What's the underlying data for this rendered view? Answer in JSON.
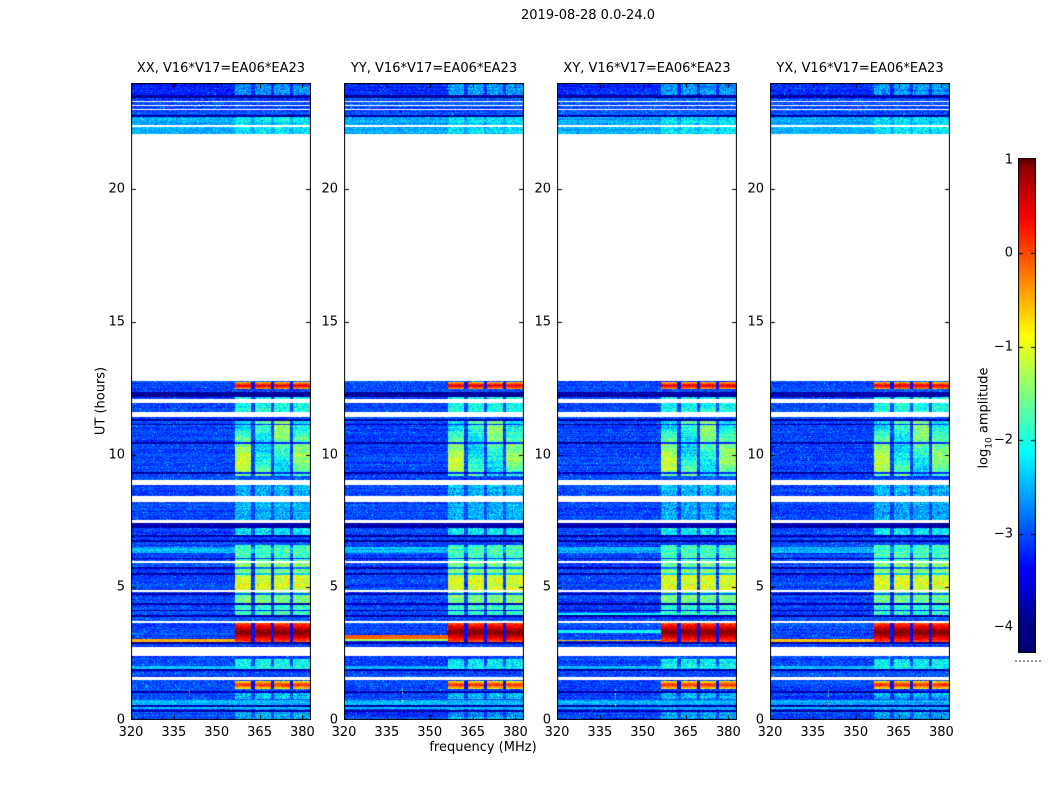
{
  "chart_data": {
    "type": "heatmap",
    "title": "2019-08-28 0.0-24.0",
    "panels": [
      {
        "id": "XX",
        "title": "XX, V16*V17=EA06*EA23",
        "seed": 1
      },
      {
        "id": "YY",
        "title": "YY, V16*V17=EA06*EA23",
        "seed": 2
      },
      {
        "id": "XY",
        "title": "XY, V16*V17=EA06*EA23",
        "seed": 3
      },
      {
        "id": "YX",
        "title": "YX, V16*V17=EA06*EA23",
        "seed": 4
      }
    ],
    "x_axis": {
      "label": "frequency (MHz)",
      "range": [
        320,
        383
      ],
      "ticks": [
        320,
        335,
        350,
        365,
        380
      ]
    },
    "y_axis": {
      "label": "UT (hours)",
      "range": [
        0,
        24
      ],
      "ticks": [
        0,
        5,
        10,
        15,
        20
      ]
    },
    "colorbar": {
      "label": "log10 amplitude",
      "colormap": "jet",
      "range": [
        -4,
        1
      ],
      "ticks": [
        1,
        0,
        -1,
        -2,
        -3,
        -4
      ]
    },
    "time_coverage": [
      [
        0,
        12.78
      ],
      [
        22.06,
        24.0
      ]
    ],
    "background_level": -3.05,
    "features": {
      "row_base": [
        [
          23.55,
          24.01,
          -3.2
        ],
        [
          22.8,
          23.45,
          -3.0
        ],
        [
          22.06,
          22.72,
          -2.55
        ]
      ],
      "white_stripes_hours": [
        [
          11.94,
          12.09
        ],
        [
          11.41,
          11.6
        ],
        [
          8.85,
          9.04
        ],
        [
          8.2,
          8.45
        ],
        [
          7.42,
          7.53
        ],
        [
          5.9,
          5.98
        ],
        [
          4.83,
          4.9
        ],
        [
          3.65,
          3.73
        ],
        [
          2.4,
          2.75
        ],
        [
          1.5,
          1.62
        ],
        [
          23.28,
          23.34
        ],
        [
          23.12,
          23.18
        ],
        [
          22.97,
          23.03
        ],
        [
          22.36,
          22.42
        ]
      ],
      "dark_lines_hours": [
        [
          12.17,
          12.36
        ],
        [
          11.28,
          11.33
        ],
        [
          11.1,
          11.15
        ],
        [
          10.4,
          10.48
        ],
        [
          9.28,
          9.33
        ],
        [
          7.23,
          7.42
        ],
        [
          6.9,
          6.97
        ],
        [
          6.72,
          6.78
        ],
        [
          6.05,
          6.12
        ],
        [
          5.7,
          5.78
        ],
        [
          5.45,
          5.52
        ],
        [
          4.72,
          4.78
        ],
        [
          4.35,
          4.42
        ],
        [
          4.1,
          4.16
        ],
        [
          3.88,
          3.94
        ],
        [
          2.88,
          2.95
        ],
        [
          1.86,
          1.92
        ],
        [
          1.0,
          1.1
        ],
        [
          0.5,
          0.56
        ],
        [
          0.3,
          0.36
        ],
        [
          23.45,
          23.55
        ],
        [
          22.72,
          22.8
        ]
      ],
      "bright_stripes_hours": [
        [
          6.3,
          6.5
        ],
        [
          1.92,
          2.05
        ],
        [
          0.4,
          0.75
        ]
      ],
      "rfi_band": {
        "freq_columns": [
          [
            356.5,
            362
          ],
          [
            363.5,
            369
          ],
          [
            370.2,
            375.5
          ],
          [
            376.8,
            382.5
          ]
        ],
        "activity": [
          {
            "hours": [
              12.47,
              12.72
            ],
            "level": 0.05,
            "style": "hot"
          },
          {
            "hours": [
              11.6,
              12.17
            ],
            "level": -2.05
          },
          {
            "hours": [
              9.2,
              11.28
            ],
            "level": -1.85,
            "blobby": true
          },
          {
            "hours": [
              8.45,
              8.85
            ],
            "level": -2.5
          },
          {
            "hours": [
              7.55,
              8.2
            ],
            "level": -2.55
          },
          {
            "hours": [
              6.97,
              7.23
            ],
            "level": -2.2
          },
          {
            "hours": [
              5.98,
              6.6
            ],
            "level": -1.8
          },
          {
            "hours": [
              5.52,
              5.9
            ],
            "level": -1.5
          },
          {
            "hours": [
              4.9,
              5.52
            ],
            "level": -1.05
          },
          {
            "hours": [
              4.42,
              4.83
            ],
            "level": -1.55
          },
          {
            "hours": [
              3.94,
              4.35
            ],
            "level": -1.9
          },
          {
            "hours": [
              2.95,
              3.65
            ],
            "level": 0.55,
            "style": "hot"
          },
          {
            "hours": [
              1.92,
              2.3
            ],
            "level": -2.15
          },
          {
            "hours": [
              1.17,
              1.47
            ],
            "level": -0.3,
            "style": "hot"
          },
          {
            "hours": [
              0.8,
              1.1
            ],
            "level": -2.45
          },
          {
            "hours": [
              0.05,
              0.4
            ],
            "level": -2.6
          },
          {
            "hours": [
              23.55,
              24.0
            ],
            "level": -2.65
          },
          {
            "hours": [
              22.06,
              22.72
            ],
            "level": -2.3
          }
        ]
      },
      "dot_column": {
        "freq": 340.5,
        "hours": [
          0.5,
          1.15
        ],
        "level": -1.1
      },
      "panel_stripes": {
        "XX": [
          {
            "hours": [
              2.95,
              3.06
            ],
            "level": -0.5
          }
        ],
        "YY": [
          {
            "hours": [
              3.06,
              3.22
            ],
            "level": -0.1
          },
          {
            "hours": [
              2.96,
              3.04
            ],
            "level": -1.3
          }
        ],
        "XY": [
          {
            "hours": [
              3.94,
              4.04
            ],
            "level": -2.15
          },
          {
            "hours": [
              3.28,
              3.38
            ],
            "level": -2.05
          },
          {
            "hours": [
              2.96,
              3.03
            ],
            "level": -0.55
          }
        ],
        "YX": [
          {
            "hours": [
              2.95,
              3.05
            ],
            "level": -0.55
          }
        ]
      }
    }
  }
}
